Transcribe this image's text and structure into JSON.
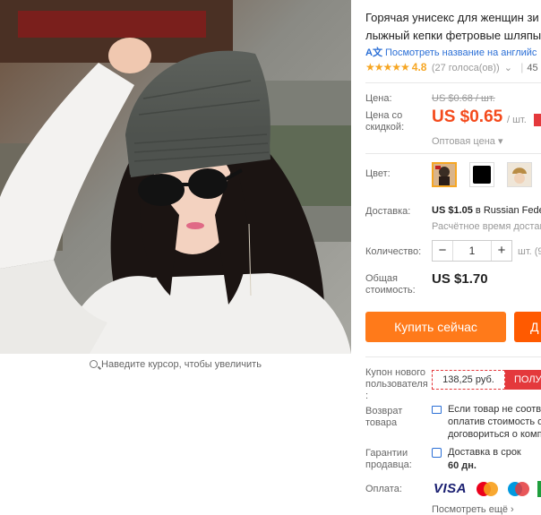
{
  "gallery": {
    "image_alt": "Woman wearing a gray knit slouchy beanie and dark sunglasses",
    "zoom_hint": "Наведите курсор, чтобы увеличить"
  },
  "product": {
    "title_line1": "Горячая унисекс для женщин зи",
    "title_line2": "лыжный кепки фетровые шляпы",
    "translate_link": "Посмотреть название на английс",
    "rating_value": "4.8",
    "rating_fraction": 0.96,
    "reviews": "(27 голоса(ов))",
    "orders": "45"
  },
  "price": {
    "label": "Цена:",
    "old": "US $0.68 / шт.",
    "discount_label_1": "Цена со",
    "discount_label_2": "скидкой:",
    "sale": "US $0.65",
    "unit": "/ шт.",
    "wholesale": "Оптовая цена"
  },
  "color": {
    "label": "Цвет:",
    "swatches": [
      {
        "name": "photo-dark",
        "color": "#4a3b30"
      },
      {
        "name": "black",
        "color": "#000000"
      },
      {
        "name": "photo-khaki",
        "color": "#b88c44"
      },
      {
        "name": "photo-gray",
        "color": "#5a5a5a"
      }
    ]
  },
  "shipping": {
    "label": "Доставка:",
    "price": "US $1.05",
    "text": " в Russian Fede",
    "time": "Расчётное время доставк"
  },
  "quantity": {
    "label": "Количество:",
    "value": "1",
    "minus": "−",
    "plus": "+",
    "unit": "шт. (9"
  },
  "total": {
    "label_1": "Общая",
    "label_2": "стоимость:",
    "value": "US $1.70"
  },
  "actions": {
    "buy_now": "Купить сейчас",
    "add_to_cart": "Д"
  },
  "coupon": {
    "label_1": "Купон нового",
    "label_2": "пользователя",
    "label_3": ":",
    "value": "138,25 руб.",
    "get": "ПОЛУ"
  },
  "returns": {
    "label_1": "Возврат",
    "label_2": "товара",
    "line1": "Если товар не соотве",
    "line2": "оплатив стоимость о",
    "line3": "договориться о комп"
  },
  "guarantee": {
    "label_1": "Гарантии",
    "label_2": "продавца:",
    "line1": "Доставка в срок",
    "line2": "60 дн."
  },
  "payment": {
    "label": "Оплата:",
    "visa": "VISA",
    "more_link": "Посмотреть ещё",
    "more_arrow": "›"
  },
  "colors": {
    "accent_orange": "#ff7a1a",
    "sale_red": "#f44a1c",
    "star": "#f6a623",
    "link_blue": "#2b6fd6"
  }
}
